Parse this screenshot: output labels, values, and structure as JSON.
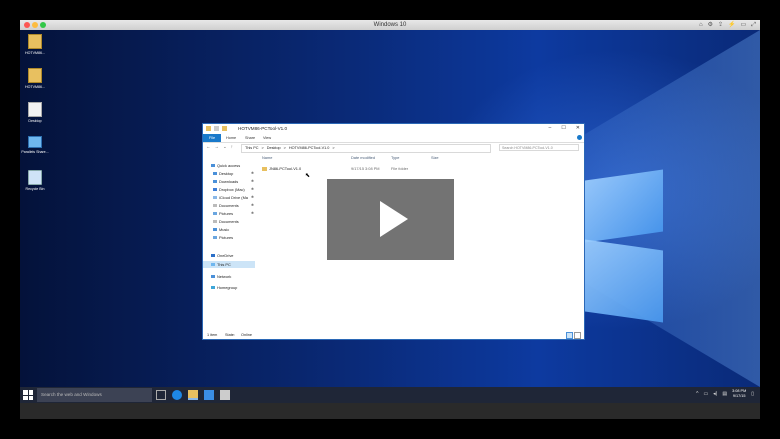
{
  "vm": {
    "title": "Windows 10"
  },
  "desktop": {
    "icons": [
      {
        "label": "HOTVM86...",
        "icon": "zip-folder-icon"
      },
      {
        "label": "HOTVM86...",
        "icon": "zip-folder-icon"
      },
      {
        "label": "Desktop",
        "icon": "document-icon"
      },
      {
        "label": "Parallels Share...",
        "icon": "computer-icon"
      },
      {
        "label": "Recycle Bin",
        "icon": "recycle-bin-icon"
      }
    ]
  },
  "explorer": {
    "title": "HOTVM86-PCTool-V1.0",
    "controls": {
      "minimize": "–",
      "maximize": "☐",
      "close": "✕"
    },
    "ribbon": {
      "file": "File",
      "home": "Home",
      "share": "Share",
      "view": "View"
    },
    "address": {
      "path": [
        "This PC",
        ">",
        "Desktop",
        ">",
        "HOTVM86-PCTool-V1.0",
        ">"
      ],
      "search_placeholder": "Search HOTVM86-PCTool-V1.0"
    },
    "nav": [
      {
        "label": "Quick access",
        "pin": ""
      },
      {
        "label": "Desktop",
        "pin": "✱"
      },
      {
        "label": "Downloads",
        "pin": "✱"
      },
      {
        "label": "Dropbox (Mac)",
        "pin": "✱"
      },
      {
        "label": "iCloud Drive (Ma",
        "pin": "✱"
      },
      {
        "label": "Documents",
        "pin": "✱"
      },
      {
        "label": "Pictures",
        "pin": "✱"
      },
      {
        "label": "Documents",
        "pin": ""
      },
      {
        "label": "Music",
        "pin": ""
      },
      {
        "label": "Pictures",
        "pin": ""
      },
      {
        "label": "OneDrive",
        "pin": ""
      },
      {
        "label": "This PC",
        "pin": ""
      },
      {
        "label": "Network",
        "pin": ""
      },
      {
        "label": "Homegroup",
        "pin": ""
      }
    ],
    "columns": [
      "Name",
      "Date modified",
      "Type",
      "Size"
    ],
    "files": [
      {
        "name": "JN86-PCTool-V1.0",
        "date": "9/17/15 3:08 PM",
        "type": "File folder",
        "size": ""
      }
    ],
    "status": {
      "count": "1 item",
      "state_label": "State:",
      "state_value": "Online"
    }
  },
  "taskbar": {
    "search_placeholder": "Search the web and Windows",
    "clock_time": "3:08 PM",
    "clock_date": "9/17/15"
  },
  "colors": {
    "accent": "#1979ca",
    "selection": "#cce4f7",
    "taskbar": "#1f2637"
  }
}
